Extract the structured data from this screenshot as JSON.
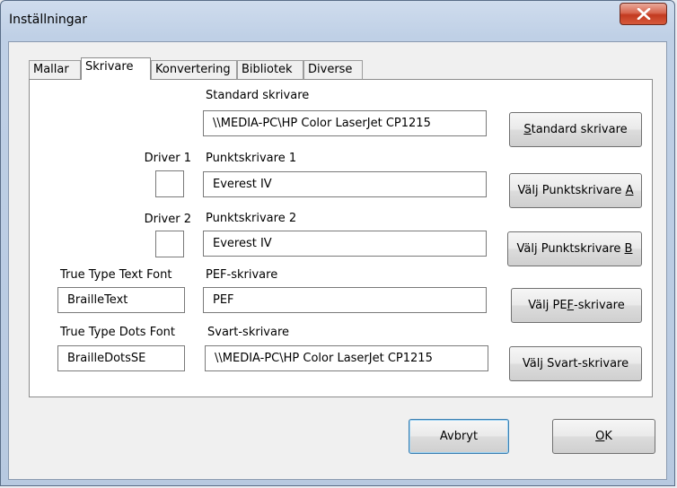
{
  "window": {
    "title": "Inställningar"
  },
  "tabs": [
    {
      "label": "Mallar"
    },
    {
      "label": "Skrivare"
    },
    {
      "label": "Konvertering"
    },
    {
      "label": "Bibliotek"
    },
    {
      "label": "Diverse"
    }
  ],
  "active_tab": "Skrivare",
  "printer": {
    "standard_label": "Standard skrivare",
    "standard_value": "\\\\MEDIA-PC\\HP Color LaserJet CP1215",
    "driver1_label": "Driver 1",
    "driver1_value": "",
    "dot1_label": "Punktskrivare 1",
    "dot1_value": "Everest IV",
    "driver2_label": "Driver 2",
    "driver2_value": "",
    "dot2_label": "Punktskrivare 2",
    "dot2_value": "Everest IV",
    "tt_text_label": "True Type Text Font",
    "tt_text_value": "BrailleText",
    "pef_label": "PEF-skrivare",
    "pef_value": "PEF",
    "tt_dots_label": "True Type Dots Font",
    "tt_dots_value": "BrailleDotsSE",
    "black_label": "Svart-skrivare",
    "black_value": "\\\\MEDIA-PC\\HP Color LaserJet CP1215"
  },
  "buttons": {
    "standard": {
      "mnemonic": "S",
      "rest": "tandard skrivare"
    },
    "dot_a": {
      "pre": "Välj Punktskrivare ",
      "mnemonic": "A"
    },
    "dot_b": {
      "pre": "Välj Punktskrivare ",
      "mnemonic": "B"
    },
    "pef": {
      "pre": "Välj PE",
      "mnemonic": "F",
      "post": "-skrivare"
    },
    "black": {
      "label": "Välj Svart-skrivare"
    },
    "cancel": {
      "label": "Avbryt"
    },
    "ok": {
      "mnemonic": "O",
      "rest": "K"
    }
  },
  "colors": {
    "close_button": "#c33a20",
    "title_bar": "#bfd0e6",
    "dialog_bg": "#f0f0f0"
  },
  "icons": {
    "close": "close-icon"
  }
}
